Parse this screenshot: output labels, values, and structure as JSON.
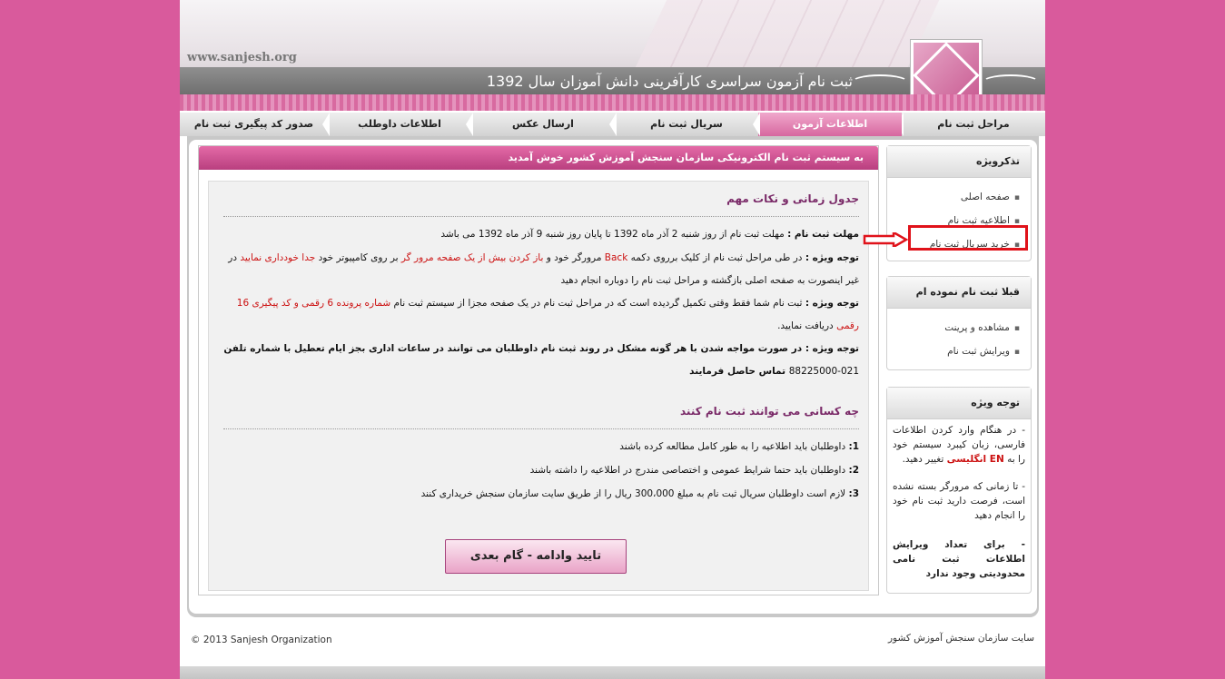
{
  "header": {
    "site_url": "www.sanjesh.org",
    "title": "ثبت نام آزمون سراسری کارآفرینی دانش آموزان سال 1392"
  },
  "nav": {
    "items": [
      {
        "label": "مراحل ثبت نام",
        "active": false
      },
      {
        "label": "اطلاعات آزمون",
        "active": true
      },
      {
        "label": "سریال ثبت نام",
        "active": false
      },
      {
        "label": "ارسال عکس",
        "active": false
      },
      {
        "label": "اطلاعات داوطلب",
        "active": false
      },
      {
        "label": "صدور کد پیگیری ثبت نام",
        "active": false
      }
    ]
  },
  "content": {
    "welcome": "به سیستم ثبت نام الکترونیکی سازمان سنجش آموزش کشور خوش آمدید",
    "section1_title": "جدول زمانی و نکات مهم",
    "deadline_label": "مهلت ثبت نام :",
    "deadline_text": "مهلت ثبت نام  از روز شنبه 2  آذر ماه  1392  تا پایان روز شنبه 9 آذر ماه 1392 می باشد",
    "note_label": "توجه ویژه :",
    "note1_a": "در طی مراحل ثبت نام از کلیک برروی دکمه",
    "note1_back": "Back",
    "note1_b": "مرورگر خود و",
    "note1_red1": "باز کردن بیش از یک صفحه مرور گر",
    "note1_c": "بر روی کامپیوتر خود",
    "note1_red2": "جدا خودداری نمایید",
    "note1_d": "در غیر اینصورت به صفحه اصلی بازگشته و مراحل ثبت نام را دوباره انجام دهید",
    "note2_a": "ثبت نام  شما فقط وقتی تکمیل گردیده است که در مراحل ثبت نام در یک صفحه مجزا از سیستم ثبت نام",
    "note2_red1": "شماره پرونده  6 رقمی و کد پیگیری 16 رقمی",
    "note2_b": "دریافت نمایید.",
    "note3_a": "در صورت مواجه شدن با هر گونه مشکل در روند ثبت نام  داوطلبان می توانند در ساعات اداری بجز ایام تعطیل با شماره تلفن",
    "note3_phone": "021-88225000",
    "note3_b": "تماس حاصل فرمایند",
    "section2_title": "چه کسانی می توانند ثبت نام کنند",
    "items": [
      {
        "num": "1:",
        "text": "داوطلبان باید اطلاعیه را به طور کامل مطالعه کرده باشند"
      },
      {
        "num": "2:",
        "text": "داوطلبان باید حتما شرایط عمومی و اختصاصی مندرج در اطلاعیه را داشته باشند"
      },
      {
        "num": "3:",
        "text": "لازم است داوطلبان سریال ثبت نام به مبلغ 300،000 ریال را از طریق سایت سازمان سنجش خریداری کنند"
      }
    ],
    "continue_label": "تایید وادامه - گام بعدی"
  },
  "sidebar": {
    "reminder_title": "تذکرویژه",
    "reminder_links": [
      "صفحه اصلی",
      "اطلاعیه ثبت نام",
      "خرید سریال ثبت نام"
    ],
    "registered_title": "قبلا ثبت نام نموده ام",
    "registered_links": [
      "مشاهده و پرینت",
      "ویرایش ثبت نام"
    ],
    "notice_title": "توجه ویژه",
    "notice1_a": "- در هنگام وارد کردن اطلاعات فارسی، زبان کیبرد سیستم خود را به",
    "notice1_red": "EN انگلیسی",
    "notice1_b": "تغییر دهید.",
    "notice2": "- تا زمانی که مرورگر بسته نشده است، فرصت دارید ثبت نام خود را انجام دهید",
    "notice3": "- برای تعداد ویرایش اطلاعات ثبت نامی محدودیتی وجود ندارد"
  },
  "footer": {
    "copyright": "© 2013 Sanjesh Organization",
    "site_name": "سایت سازمان سنجش آموزش کشور"
  },
  "colors": {
    "background": "#d95a9c",
    "accent": "#c7508f",
    "highlight": "#e0121a"
  }
}
